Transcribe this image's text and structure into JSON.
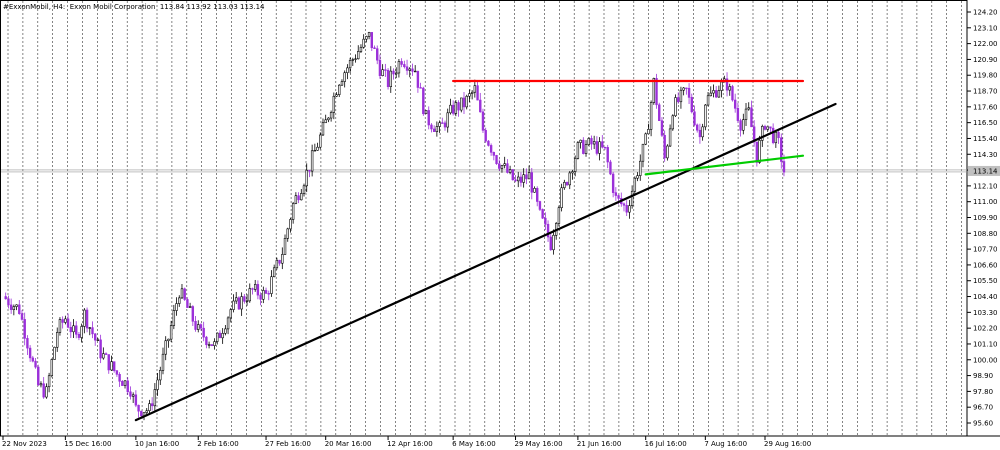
{
  "header": {
    "symbol": "#ExxonMobil, H4:",
    "name": "Exxon Mobil Corporation",
    "ohlc": "113.84 113.92 113.03 113.14"
  },
  "chart_data": {
    "type": "candlestick",
    "title": "",
    "xlabel": "",
    "ylabel": "",
    "grid": true,
    "ylim": [
      95.0,
      125.0
    ],
    "y_ticks": [
      "124.20",
      "123.10",
      "122.00",
      "120.90",
      "119.80",
      "118.70",
      "117.60",
      "116.50",
      "115.40",
      "114.30",
      "113.20",
      "112.10",
      "111.00",
      "109.90",
      "108.80",
      "107.70",
      "106.60",
      "105.50",
      "104.40",
      "103.30",
      "102.20",
      "101.10",
      "100.00",
      "98.90",
      "97.80",
      "96.70",
      "95.60"
    ],
    "x_ticks": [
      "22 Nov 2023",
      "15 Dec 16:00",
      "10 Jan 16:00",
      "2 Feb 16:00",
      "27 Feb 16:00",
      "20 Mar 16:00",
      "12 Apr 16:00",
      "6 May 16:00",
      "29 May 16:00",
      "21 Jun 16:00",
      "16 Jul 16:00",
      "7 Aug 16:00",
      "29 Aug 16:00"
    ],
    "current_price": "113.14",
    "price_path": [
      [
        "22 Nov 2023",
        104.4
      ],
      [
        "28 Nov",
        103.5
      ],
      [
        "5 Dec",
        98.2
      ],
      [
        "8 Dec",
        97.7
      ],
      [
        "12 Dec",
        102.0
      ],
      [
        "15 Dec 16:00",
        102.9
      ],
      [
        "19 Dec",
        101.5
      ],
      [
        "22 Dec",
        103.2
      ],
      [
        "28 Dec",
        100.5
      ],
      [
        "3 Jan",
        99.0
      ],
      [
        "8 Jan",
        98.0
      ],
      [
        "10 Jan 16:00",
        96.6
      ],
      [
        "15 Jan",
        96.5
      ],
      [
        "22 Jan",
        101.5
      ],
      [
        "26 Jan",
        104.8
      ],
      [
        "2 Feb 16:00",
        102.0
      ],
      [
        "8 Feb",
        101.0
      ],
      [
        "14 Feb",
        103.5
      ],
      [
        "22 Feb",
        104.8
      ],
      [
        "27 Feb 16:00",
        104.5
      ],
      [
        "4 Mar",
        107.5
      ],
      [
        "8 Mar",
        110.8
      ],
      [
        "13 Mar",
        113.0
      ],
      [
        "20 Mar 16:00",
        116.5
      ],
      [
        "25 Mar",
        119.5
      ],
      [
        "1 Apr",
        121.5
      ],
      [
        "5 Apr",
        122.5
      ],
      [
        "9 Apr",
        120.3
      ],
      [
        "12 Apr 16:00",
        119.3
      ],
      [
        "17 Apr",
        121.0
      ],
      [
        "22 Apr",
        120.2
      ],
      [
        "26 Apr",
        116.8
      ],
      [
        "1 May",
        116.0
      ],
      [
        "6 May 16:00",
        117.5
      ],
      [
        "10 May",
        117.8
      ],
      [
        "14 May",
        118.8
      ],
      [
        "17 May",
        116.0
      ],
      [
        "22 May",
        114.0
      ],
      [
        "29 May 16:00",
        112.3
      ],
      [
        "3 Jun",
        112.8
      ],
      [
        "7 Jun",
        110.0
      ],
      [
        "11 Jun",
        108.1
      ],
      [
        "14 Jun",
        111.0
      ],
      [
        "21 Jun 16:00",
        114.7
      ],
      [
        "26 Jun",
        115.0
      ],
      [
        "1 Jul",
        114.5
      ],
      [
        "5 Jul",
        111.2
      ],
      [
        "9 Jul",
        110.5
      ],
      [
        "12 Jul",
        112.5
      ],
      [
        "16 Jul 16:00",
        115.2
      ],
      [
        "19 Jul",
        119.3
      ],
      [
        "23 Jul",
        114.0
      ],
      [
        "26 Jul",
        117.5
      ],
      [
        "31 Jul",
        118.7
      ],
      [
        "5 Aug",
        115.5
      ],
      [
        "7 Aug 16:00",
        118.0
      ],
      [
        "12 Aug",
        119.0
      ],
      [
        "15 Aug",
        119.2
      ],
      [
        "20 Aug",
        116.5
      ],
      [
        "23 Aug",
        117.2
      ],
      [
        "26 Aug",
        114.2
      ],
      [
        "29 Aug 16:00",
        116.5
      ],
      [
        "3 Sep",
        115.0
      ],
      [
        "5 Sep",
        113.14
      ]
    ],
    "trendlines": [
      {
        "color": "#ff0000",
        "from": [
          "6 May 16:00",
          119.4
        ],
        "to": [
          "12 Sep",
          119.4
        ]
      },
      {
        "color": "#000000",
        "from": [
          "10 Jan 16:00",
          95.8
        ],
        "to": [
          "24 Sep",
          117.8
        ]
      },
      {
        "color": "#00cc00",
        "from": [
          "16 Jul 16:00",
          112.9
        ],
        "to": [
          "12 Sep",
          114.2
        ]
      }
    ]
  },
  "colors": {
    "bull": "#000000",
    "bear": "#9b30d9",
    "grid": "#000000"
  }
}
